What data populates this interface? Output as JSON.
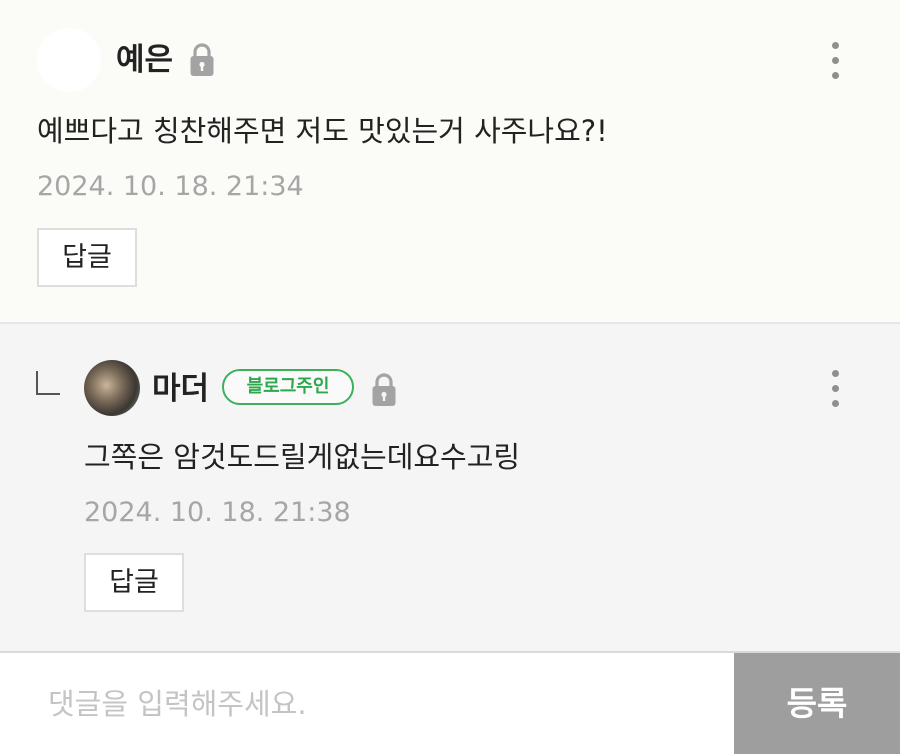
{
  "comments": [
    {
      "author": "예은",
      "text": "예쁘다고 칭찬해주면 저도 맛있는거 사주나요?!",
      "timestamp": "2024. 10. 18. 21:34",
      "reply_label": "답글",
      "icons": {
        "lock": "lock-icon",
        "more": "more-vertical-icon"
      }
    }
  ],
  "replies": [
    {
      "author": "마더",
      "badge": "블로그주인",
      "text": "그쪽은 암것도드릴게없는데요수고링",
      "timestamp": "2024. 10. 18. 21:38",
      "reply_label": "답글",
      "icons": {
        "lock": "lock-icon",
        "more": "more-vertical-icon",
        "reply_arrow": "reply-arrow-icon"
      }
    }
  ],
  "input": {
    "placeholder": "댓글을 입력해주세요.",
    "value": "",
    "submit_label": "등록"
  },
  "colors": {
    "badge_green": "#3db05a",
    "submit_bg": "#9e9e9e",
    "timestamp_gray": "#a6a6a6"
  }
}
